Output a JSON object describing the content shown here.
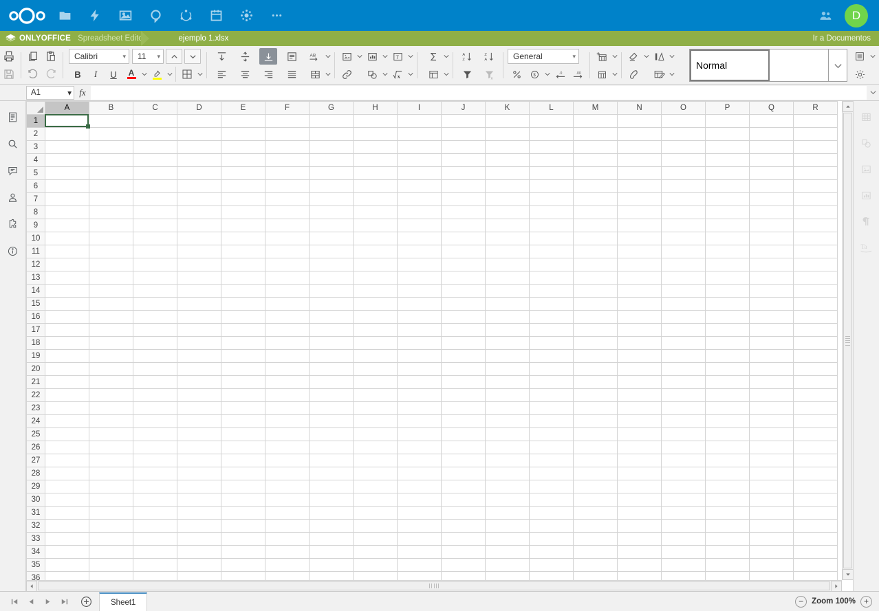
{
  "nextcloud": {
    "logo": "nextcloud-logo",
    "apps": [
      {
        "name": "files-icon",
        "label": "Files"
      },
      {
        "name": "activity-icon",
        "label": "Activity"
      },
      {
        "name": "photos-icon",
        "label": "Photos"
      },
      {
        "name": "talk-icon",
        "label": "Talk"
      },
      {
        "name": "circles-icon",
        "label": "Circles"
      },
      {
        "name": "calendar-icon",
        "label": "Calendar"
      },
      {
        "name": "deck-icon",
        "label": "Deck"
      },
      {
        "name": "more-apps-icon",
        "label": "..."
      }
    ],
    "contacts_icon": "contacts-icon",
    "avatar_initial": "D",
    "avatar_color": "#70d44b",
    "bar_color": "#0082c9"
  },
  "onlyoffice": {
    "brand": "ONLYOFFICE",
    "editor_name": "Spreadsheet Editor",
    "document_title": "ejemplo 1.xlsx",
    "go_to_documents": "Ir a Documentos",
    "bar_color": "#8faf47"
  },
  "toolbar": {
    "print_label": "Print",
    "save_label": "Save",
    "copy_label": "Copy",
    "paste_label": "Paste",
    "undo_label": "Undo",
    "redo_label": "Redo",
    "font_name": "Calibri",
    "font_size": "11",
    "increment_font_label": "Increment font size",
    "decrement_font_label": "Decrement font size",
    "bold_label": "B",
    "italic_label": "I",
    "underline_label": "U",
    "font_color_label": "A",
    "font_color": "#ff0000",
    "highlight_color": "#ffff00",
    "borders_label": "Borders",
    "align_top_label": "Align top",
    "align_middle_label": "Align middle",
    "align_bottom_label": "Align bottom",
    "wrap_text_label": "Wrap text",
    "orientation_label": "Orientation",
    "align_left_label": "Align left",
    "align_center_label": "Align center",
    "align_right_label": "Align right",
    "align_justify_label": "Justified",
    "merge_cells_label": "Merge and center",
    "insert_image_label": "Insert image",
    "insert_chart_label": "Insert chart",
    "insert_textbox_label": "Insert text box",
    "insert_hyperlink_label": "Insert hyperlink",
    "insert_shape_label": "Insert shape",
    "insert_equation_label": "Insert equation",
    "summation_label": "Summation",
    "named_range_label": "Named ranges",
    "sort_asc_label": "Sort ascending",
    "sort_desc_label": "Sort descending",
    "filter_label": "Filter",
    "clear_filter_label": "Clear filter",
    "number_format": "General",
    "percent_label": "Percent style",
    "currency_label": "Currency style",
    "decrease_decimal_label": "Decrease decimal",
    "increase_decimal_label": "Increase decimal",
    "insert_cells_label": "Insert cells",
    "delete_cells_label": "Delete cells",
    "clear_label": "Clear",
    "conditional_formatting_label": "Conditional formatting",
    "copy_style_label": "Copy style",
    "format_as_table_label": "Format as table",
    "view_settings_label": "View settings",
    "advanced_settings_label": "Advanced settings",
    "cell_styles": {
      "selected": "Normal",
      "blank": "",
      "expand_label": "Expand style gallery"
    }
  },
  "formula_bar": {
    "name_box_value": "A1",
    "fx_label": "fx",
    "formula_value": "",
    "expand_label": "Expand formula bar"
  },
  "left_rail": [
    {
      "name": "file-icon",
      "label": "File"
    },
    {
      "name": "search-icon",
      "label": "Search"
    },
    {
      "name": "comments-icon",
      "label": "Comments"
    },
    {
      "name": "collaboration-icon",
      "label": "Collaboration"
    },
    {
      "name": "plugins-icon",
      "label": "Plugins"
    },
    {
      "name": "about-icon",
      "label": "About"
    }
  ],
  "right_rail": [
    {
      "name": "table-settings-icon",
      "label": "Table settings"
    },
    {
      "name": "shape-settings-icon",
      "label": "Shape settings"
    },
    {
      "name": "image-settings-icon",
      "label": "Image settings"
    },
    {
      "name": "chart-settings-icon",
      "label": "Chart settings"
    },
    {
      "name": "paragraph-settings-icon",
      "label": "Paragraph settings"
    },
    {
      "name": "text-art-settings-icon",
      "label": "Text Art settings"
    }
  ],
  "grid": {
    "columns": [
      "A",
      "B",
      "C",
      "D",
      "E",
      "F",
      "G",
      "H",
      "I",
      "J",
      "K",
      "L",
      "M",
      "N",
      "O",
      "P",
      "Q",
      "R"
    ],
    "rows": [
      1,
      2,
      3,
      4,
      5,
      6,
      7,
      8,
      9,
      10,
      11,
      12,
      13,
      14,
      15,
      16,
      17,
      18,
      19,
      20,
      21,
      22,
      23,
      24,
      25,
      26,
      27,
      28,
      29,
      30,
      31,
      32,
      33,
      34,
      35,
      36
    ],
    "selected_cell": "A1",
    "selected_column": "A",
    "selected_row": 1,
    "selection_color": "#3a6b45",
    "cells": {}
  },
  "status_bar": {
    "first_sheet_label": "First sheet",
    "prev_sheet_label": "Previous sheet",
    "next_sheet_label": "Next sheet",
    "last_sheet_label": "Last sheet",
    "add_sheet_label": "+",
    "sheets": [
      {
        "name": "Sheet1",
        "active": true
      }
    ],
    "zoom_out_label": "−",
    "zoom_label": "Zoom 100%",
    "zoom_in_label": "+"
  }
}
